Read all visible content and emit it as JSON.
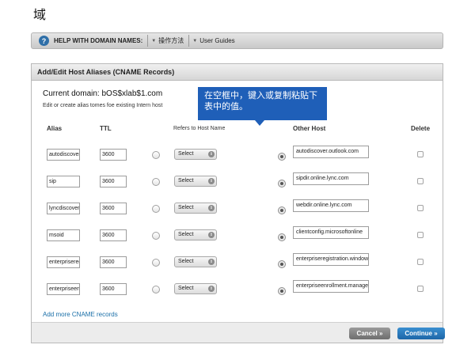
{
  "page": {
    "title": "域"
  },
  "help_bar": {
    "help_label": "HELP WITH DOMAIN NAMES:",
    "link1": "操作方法",
    "link2": "User Guides"
  },
  "panel": {
    "title": "Add/Edit Host Aliases (CNAME Records)",
    "current_domain": "Current domain: bOS$xlab$1.com",
    "subtitle": "Edit or create alias tomes foe existing Intern host",
    "tooltip": "在空框中，键入或复制粘贴下表中的值。",
    "headers": {
      "alias": "Alias",
      "ttl": "TTL",
      "refers": "Refers to Host Name",
      "other": "Other Host",
      "delete": "Delete"
    },
    "rows": [
      {
        "alias": "autodiscover",
        "ttl": "3600",
        "select": "Select",
        "other_host": "autodiscover.outlook.com"
      },
      {
        "alias": "sip",
        "ttl": "3600",
        "select": "Select",
        "other_host": "sipdir.online.lync.com"
      },
      {
        "alias": "lyncdiscover",
        "ttl": "3600",
        "select": "Select",
        "other_host": "webdir.online.lync.com"
      },
      {
        "alias": "msoid",
        "ttl": "3600",
        "select": "Select",
        "other_host": "clientconfig.microsoftonline"
      },
      {
        "alias": "enterpriseregistration",
        "ttl": "3600",
        "select": "Select",
        "other_host": "enterpriseregistration.windows"
      },
      {
        "alias": "enterpriseenrollment",
        "ttl": "3600",
        "select": "Select",
        "other_host": "enterpriseenrollment.manage"
      }
    ],
    "add_more": "Add more CNAME records",
    "cancel": "Cancel »",
    "continue": "Continue »"
  }
}
